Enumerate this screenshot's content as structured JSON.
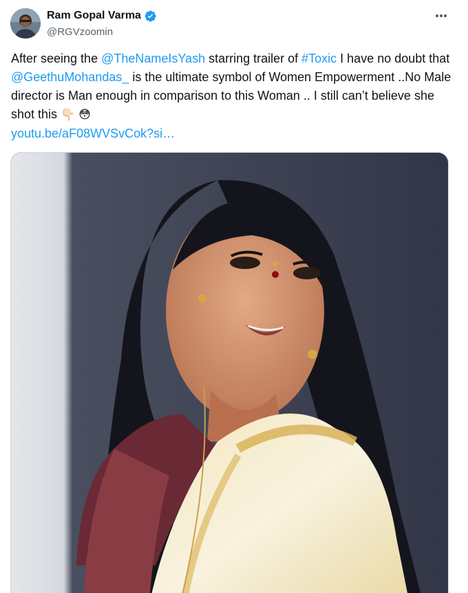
{
  "author": {
    "display_name": "Ram Gopal Varma",
    "handle": "@RGVzoomin",
    "verified_icon": "verified-badge-icon",
    "verified_color": "#1d9bf0"
  },
  "tweet": {
    "segments": [
      {
        "text": "After seeing the ",
        "type": "text"
      },
      {
        "text": "@TheNameIsYash",
        "type": "link"
      },
      {
        "text": " starring trailer of ",
        "type": "text"
      },
      {
        "text": "#Toxic",
        "type": "link"
      },
      {
        "text": " I have no doubt that ",
        "type": "text"
      },
      {
        "text": "@GeethuMohandas_",
        "type": "link"
      },
      {
        "text": "  is the ultimate symbol of Women Empowerment ..No Male director is Man enough in comparison to this Woman .. I still can’t believe she shot this ",
        "type": "text"
      },
      {
        "text": "👇🏻",
        "type": "emoji"
      },
      {
        "text": " ",
        "type": "text"
      },
      {
        "text": "😳",
        "type": "emoji"
      },
      {
        "text": "youtu.be/aF08WVSvCok?si…",
        "type": "url"
      }
    ]
  },
  "more_icon": "more-horizontal-icon",
  "media": {
    "kind": "photo",
    "subject": "portrait-photo"
  },
  "colors": {
    "link": "#1d9bf0",
    "text": "#0f1419",
    "secondary": "#536471",
    "border": "#cfd9de"
  }
}
